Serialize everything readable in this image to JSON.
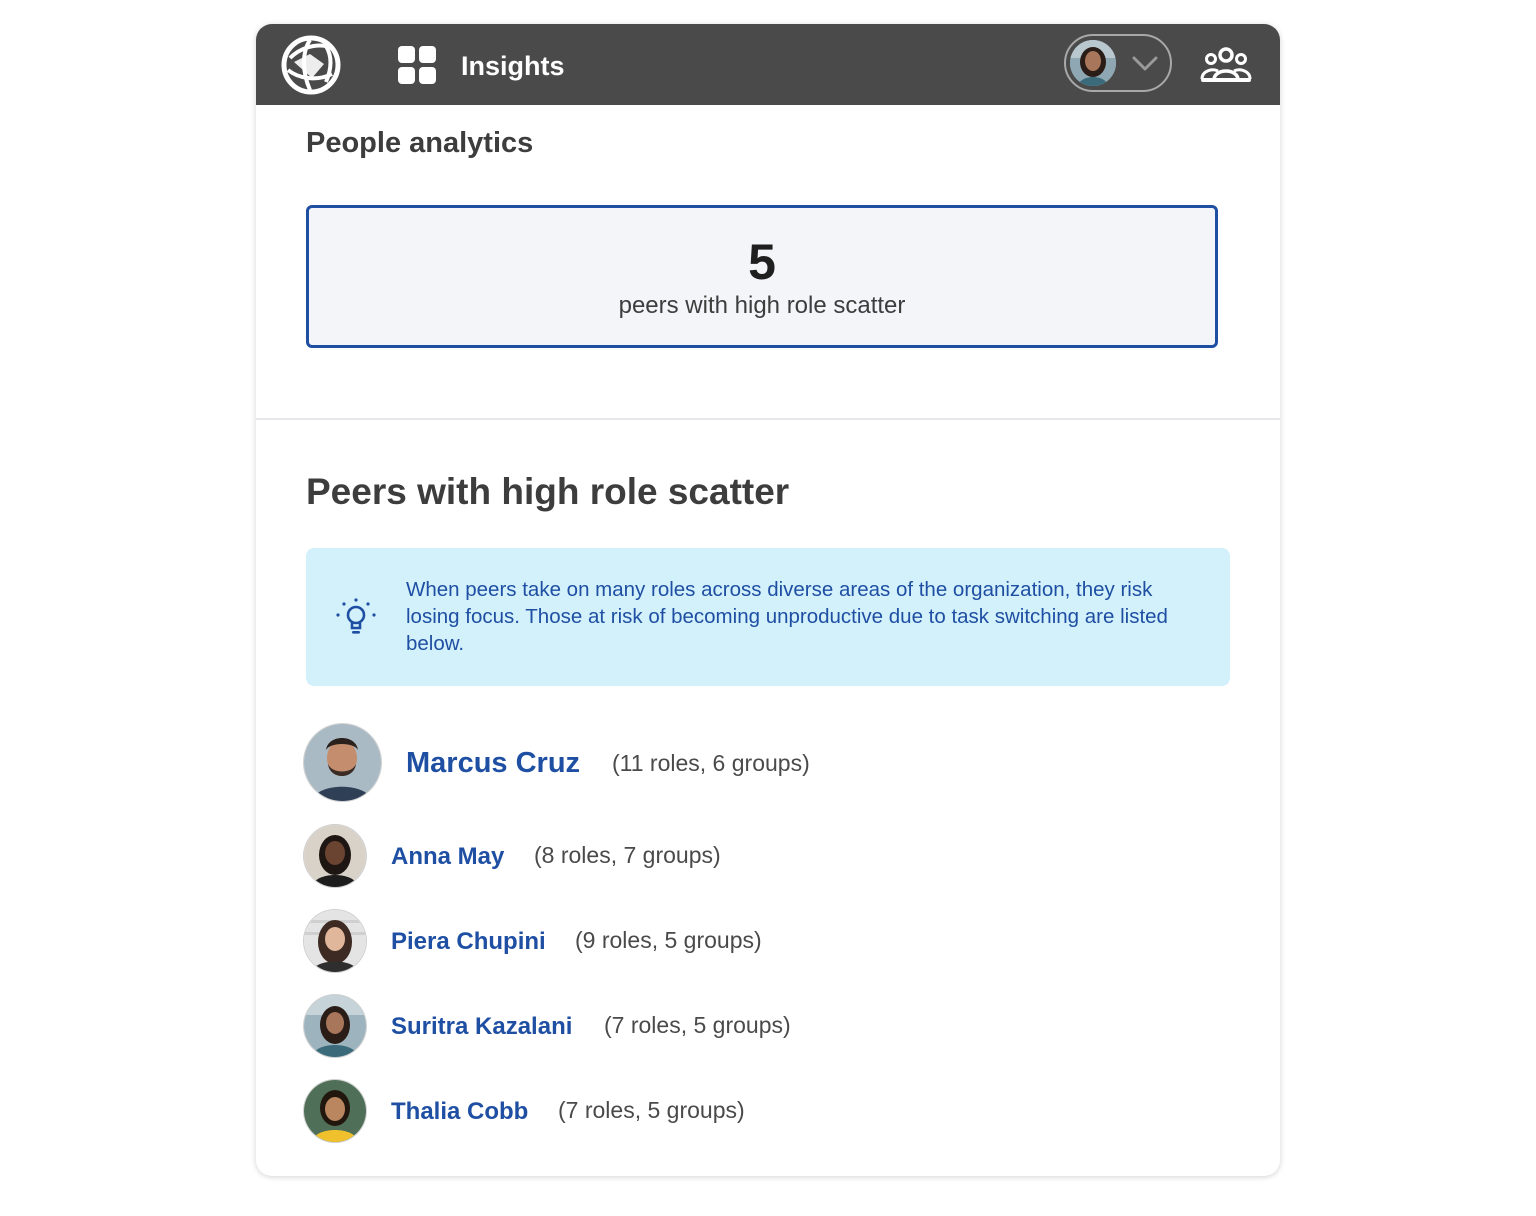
{
  "header": {
    "app_title": "Insights",
    "logo_icon": "globe-logo-icon",
    "apps_icon": "app-grid-icon",
    "profile_chevron_icon": "chevron-down-icon",
    "people_icon": "people-group-icon",
    "background_color": "#4a4a4a"
  },
  "analytics": {
    "heading": "People analytics",
    "stat_value": "5",
    "stat_label": "peers with high role scatter",
    "accent_color": "#1f4fa3"
  },
  "peers_section": {
    "heading": "Peers with high role scatter",
    "tip_icon": "lightbulb-icon",
    "tip_text": "When peers take on many roles across diverse areas of the organization, they risk losing focus. Those at risk of becoming unproductive due to task switching are listed below.",
    "tip_background": "#d3f1fb",
    "peers": [
      {
        "name": "Marcus Cruz",
        "details": "(11 roles, 6 groups)"
      },
      {
        "name": "Anna May",
        "details": "(8 roles, 7 groups)"
      },
      {
        "name": "Piera Chupini",
        "details": "(9 roles, 5 groups)"
      },
      {
        "name": "Suritra Kazalani",
        "details": "(7 roles, 5 groups)"
      },
      {
        "name": "Thalia Cobb",
        "details": "(7 roles, 5 groups)"
      }
    ]
  }
}
